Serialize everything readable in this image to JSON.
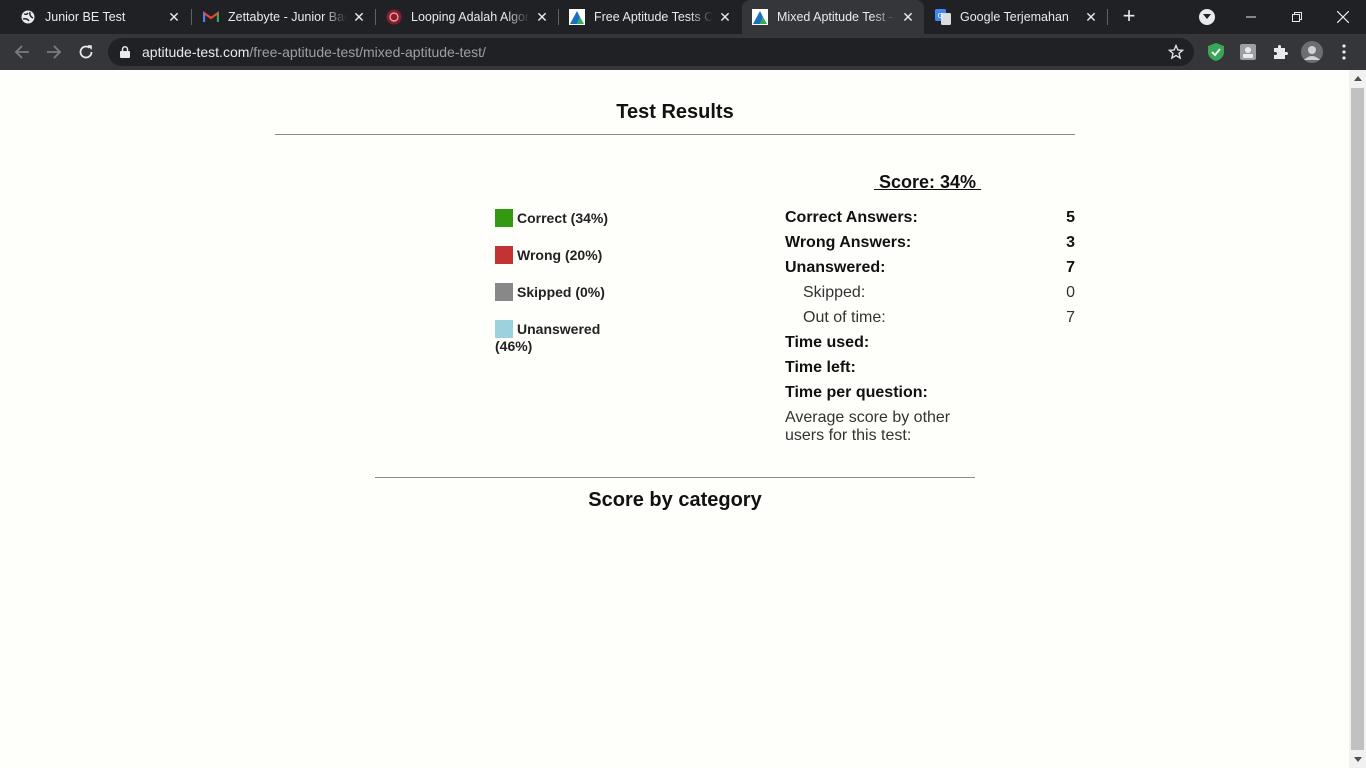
{
  "browser": {
    "tabs": [
      {
        "title": "Junior BE Test",
        "icon": "globe-icon"
      },
      {
        "title": "Zettabyte - Junior Backend",
        "icon": "gmail-icon"
      },
      {
        "title": "Looping Adalah Algoritma",
        "icon": "site-icon"
      },
      {
        "title": "Free Aptitude Tests Online",
        "icon": "aptitude-icon"
      },
      {
        "title": "Mixed Aptitude Test - Free",
        "icon": "aptitude-icon",
        "active": true
      },
      {
        "title": "Google Terjemahan",
        "icon": "translate-icon"
      }
    ],
    "url_host": "aptitude-test.com",
    "url_path": "/free-aptitude-test/mixed-aptitude-test/"
  },
  "page": {
    "title": "Test Results",
    "legend": [
      {
        "label": "Correct (34%)",
        "color": "#339911"
      },
      {
        "label": "Wrong (20%)",
        "color": "#c33333"
      },
      {
        "label": "Skipped (0%)",
        "color": "#888888"
      },
      {
        "label": "Unanswered (46%)",
        "color": "#9bd2de"
      }
    ],
    "score_heading": " Score: 34% ",
    "stats": {
      "correct": {
        "label": "Correct Answers:",
        "value": "5"
      },
      "wrong": {
        "label": "Wrong Answers:",
        "value": "3"
      },
      "unanswered": {
        "label": "Unanswered:",
        "value": "7"
      },
      "skipped": {
        "label": "Skipped:",
        "value": "0"
      },
      "out_of_time": {
        "label": "Out of time:",
        "value": "7"
      },
      "time_used": {
        "label": "Time used:"
      },
      "time_left": {
        "label": "Time left:"
      },
      "time_per_question": {
        "label": "Time per question:"
      },
      "average": {
        "label": "Average score by other users for this test:"
      }
    },
    "category_title": "Score by category"
  }
}
